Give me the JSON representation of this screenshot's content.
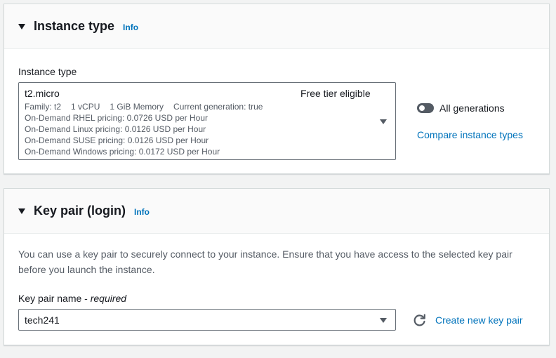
{
  "instance_type": {
    "title": "Instance type",
    "info": "Info",
    "field_label": "Instance type",
    "selected": {
      "name": "t2.micro",
      "badge": "Free tier eligible",
      "family": "Family: t2",
      "vcpu": "1 vCPU",
      "memory": "1 GiB Memory",
      "generation": "Current generation: true",
      "pricing": [
        "On-Demand RHEL pricing: 0.0726 USD per Hour",
        "On-Demand Linux pricing: 0.0126 USD per Hour",
        "On-Demand SUSE pricing: 0.0126 USD per Hour",
        "On-Demand Windows pricing: 0.0172 USD per Hour"
      ]
    },
    "all_generations_label": "All generations",
    "all_generations_on": false,
    "compare_link": "Compare instance types"
  },
  "key_pair": {
    "title": "Key pair (login)",
    "info": "Info",
    "description": "You can use a key pair to securely connect to your instance. Ensure that you have access to the selected key pair before you launch the instance.",
    "field_label": "Key pair name - ",
    "field_required": "required",
    "selected": "tech241",
    "create_link": "Create new key pair"
  },
  "colors": {
    "link": "#0073bb",
    "text": "#16191f",
    "muted": "#545b64"
  }
}
